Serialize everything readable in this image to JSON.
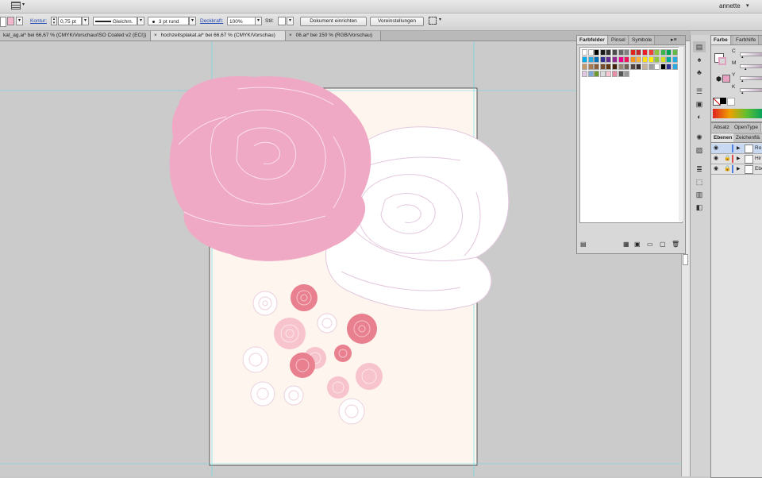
{
  "app": {
    "user": "annette",
    "user_arrow": "▾"
  },
  "control_bar": {
    "stroke_label": "Kontur:",
    "stroke_weight": "0,75 pt",
    "stroke_style": "Gleichm.",
    "brush": "3 pt rund",
    "opacity_label": "Deckkraft:",
    "opacity_value": "100%",
    "style_label": "Stil:",
    "document_setup": "Dokument einrichten",
    "preferences": "Voreinstellungen"
  },
  "doc_tabs": [
    {
      "label": "kat_ag.ai* bei 66,67 % (CMYK/Vorschau/ISO Coated v2 (ECI))",
      "active": false
    },
    {
      "label": "hochzeitsplakat.ai* bei 66,67 % (CMYK/Vorschau)",
      "active": true
    },
    {
      "label": "06.ai* bei 150 % (RGB/Vorschau)",
      "active": false
    }
  ],
  "close_glyph": "×",
  "swatches_panel": {
    "tabs": [
      "Farbfelder",
      "Pinsel",
      "Symbole"
    ],
    "row1": [
      "#ffffff",
      "#f6f6f6",
      "#000000",
      "#1a1a1a",
      "#333333",
      "#4d4d4d",
      "#666666",
      "#808080",
      "#e2231a",
      "#c1272d",
      "#ed1c24",
      "#ef4136",
      "#8cc63f",
      "#39b54a",
      "#00a651",
      "#62bb46"
    ],
    "row2": [
      "#00aeef",
      "#29abe2",
      "#0071bc",
      "#2e3192",
      "#662d91",
      "#92278f",
      "#ec008c",
      "#ed145b",
      "#f7941d",
      "#fbb040",
      "#ffde17",
      "#fff200",
      "#8dc63f",
      "#d7df23",
      "#00a99d",
      "#27aae1"
    ],
    "row3": [
      "#c49a6c",
      "#a97c50",
      "#8b5e3c",
      "#754c29",
      "#603913",
      "#42210b",
      "#998675",
      "#736357",
      "#534741",
      "#362f2d",
      "#c7b299",
      "#9e9e9e",
      "#ffffff",
      "#000000",
      "#2e3192",
      "#29abe2"
    ],
    "row4": [
      "#e0c8e0",
      "#7aa7d6",
      "#6c9a2e",
      "#dcdcdc",
      "#f9c5d3",
      "#e58fa7",
      "#555555",
      "#999999"
    ]
  },
  "color_panel": {
    "tabs": [
      "Farbe",
      "Farbhilfe"
    ],
    "channels": [
      "C",
      "M",
      "Y",
      "K"
    ]
  },
  "type_panel": {
    "tabs": [
      "Absatz",
      "OpenType"
    ]
  },
  "layers_panel": {
    "tabs": [
      "Ebenen",
      "Zeichenflä"
    ],
    "layers": [
      {
        "name": "Ro",
        "color": "#4f7fe0"
      },
      {
        "name": "Hir",
        "color": "#e04f4f"
      },
      {
        "name": "Ebe",
        "color": "#4f7fe0"
      }
    ]
  },
  "canvas": {
    "artboard_color": "#fdf5ee",
    "rose_pink": "#f0a9c4",
    "rose_red": "#e8808f",
    "guide_color": "#5fd8e8"
  }
}
